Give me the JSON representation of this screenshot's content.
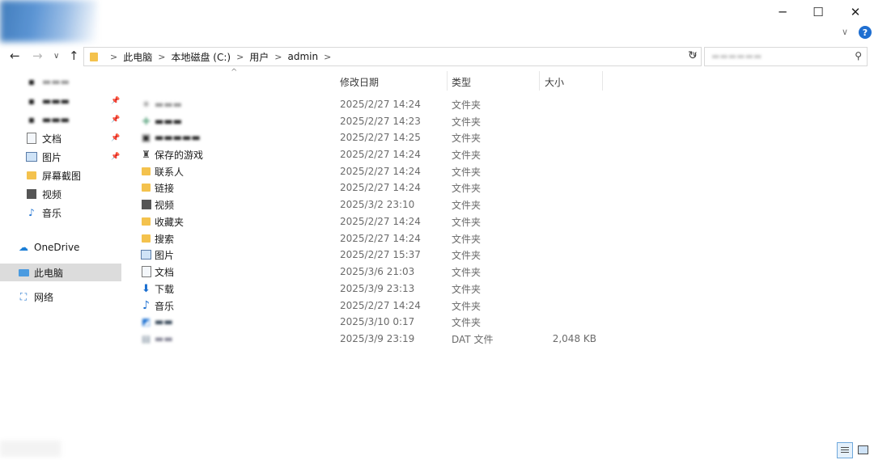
{
  "window": {
    "minimize_glyph": "─",
    "maximize_glyph": "☐",
    "close_glyph": "✕",
    "help_glyph": "?",
    "ribbon_expand_glyph": "∨"
  },
  "nav": {
    "back_glyph": "←",
    "forward_glyph": "→",
    "recent_glyph": "∨",
    "up_glyph": "↑",
    "refresh_glyph": "↻",
    "address_dropdown_glyph": "∨",
    "breadcrumb": [
      "此电脑",
      "本地磁盘 (C:)",
      "用户",
      "admin"
    ],
    "search_icon": "search-icon"
  },
  "sidebar": {
    "items": [
      {
        "label": "",
        "icon": "blurred-icon",
        "pinned": false,
        "blurred": true
      },
      {
        "label": "",
        "icon": "blurred-icon",
        "pinned": true,
        "blurred": true
      },
      {
        "label": "",
        "icon": "blurred-icon",
        "pinned": true,
        "blurred": true
      },
      {
        "label": "文档",
        "icon": "documents-icon",
        "pinned": true
      },
      {
        "label": "图片",
        "icon": "pictures-icon",
        "pinned": true
      },
      {
        "label": "屏幕截图",
        "icon": "folder-icon",
        "pinned": false
      },
      {
        "label": "视频",
        "icon": "videos-icon",
        "pinned": false
      },
      {
        "label": "音乐",
        "icon": "music-icon",
        "pinned": false
      },
      {
        "label": "OneDrive",
        "icon": "onedrive-icon",
        "root": true
      },
      {
        "label": "此电脑",
        "icon": "this-pc-icon",
        "root": true,
        "selected": true
      },
      {
        "label": "网络",
        "icon": "network-icon",
        "root": true
      }
    ]
  },
  "columns": {
    "name_sort_glyph": "^",
    "date": "修改日期",
    "type": "类型",
    "size": "大小"
  },
  "files": [
    {
      "name": "",
      "blurred": true,
      "icon": "blurred-icon",
      "date": "2025/2/27 14:24",
      "type": "文件夹",
      "size": ""
    },
    {
      "name": "",
      "blurred": true,
      "icon": "blurred-icon",
      "date": "2025/2/27 14:23",
      "type": "文件夹",
      "size": ""
    },
    {
      "name": "",
      "blurred": true,
      "icon": "blurred-icon",
      "date": "2025/2/27 14:25",
      "type": "文件夹",
      "size": ""
    },
    {
      "name": "保存的游戏",
      "icon": "saved-games-icon",
      "date": "2025/2/27 14:24",
      "type": "文件夹",
      "size": ""
    },
    {
      "name": "联系人",
      "icon": "contacts-icon",
      "date": "2025/2/27 14:24",
      "type": "文件夹",
      "size": ""
    },
    {
      "name": "链接",
      "icon": "links-icon",
      "date": "2025/2/27 14:24",
      "type": "文件夹",
      "size": ""
    },
    {
      "name": "视频",
      "icon": "videos-icon",
      "date": "2025/3/2 23:10",
      "type": "文件夹",
      "size": ""
    },
    {
      "name": "收藏夹",
      "icon": "favorites-icon",
      "date": "2025/2/27 14:24",
      "type": "文件夹",
      "size": ""
    },
    {
      "name": "搜索",
      "icon": "searches-icon",
      "date": "2025/2/27 14:24",
      "type": "文件夹",
      "size": ""
    },
    {
      "name": "图片",
      "icon": "pictures-icon",
      "date": "2025/2/27 15:37",
      "type": "文件夹",
      "size": ""
    },
    {
      "name": "文档",
      "icon": "documents-icon",
      "date": "2025/3/6 21:03",
      "type": "文件夹",
      "size": ""
    },
    {
      "name": "下载",
      "icon": "downloads-icon",
      "date": "2025/3/9 23:13",
      "type": "文件夹",
      "size": ""
    },
    {
      "name": "音乐",
      "icon": "music-icon",
      "date": "2025/2/27 14:24",
      "type": "文件夹",
      "size": ""
    },
    {
      "name": "",
      "blurred": true,
      "icon": "blurred-icon",
      "date": "2025/3/10 0:17",
      "type": "文件夹",
      "size": ""
    },
    {
      "name": "",
      "blurred": true,
      "icon": "blurred-icon",
      "date": "2025/3/9 23:19",
      "type": "DAT 文件",
      "size": "2,048 KB"
    }
  ],
  "colors": {
    "folder": "#f4c24d",
    "accent": "#1f6fd1",
    "selected_bg": "#dcdcdc"
  }
}
